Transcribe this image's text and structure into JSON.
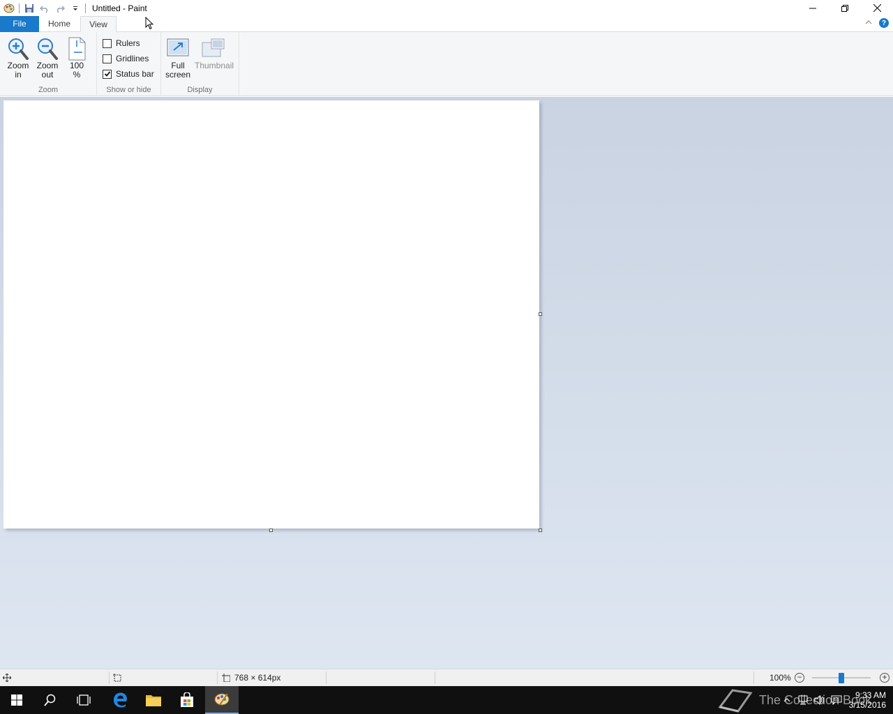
{
  "window": {
    "title": "Untitled - Paint"
  },
  "tabs": {
    "file": "File",
    "home": "Home",
    "view": "View"
  },
  "ribbon": {
    "zoom_group": {
      "label": "Zoom",
      "zoom_in_line1": "Zoom",
      "zoom_in_line2": "in",
      "zoom_out_line1": "Zoom",
      "zoom_out_line2": "out",
      "hundred_line1": "100",
      "hundred_line2": "%"
    },
    "show_hide_group": {
      "label": "Show or hide",
      "rulers": "Rulers",
      "rulers_checked": false,
      "gridlines": "Gridlines",
      "gridlines_checked": false,
      "status_bar": "Status bar",
      "status_bar_checked": true
    },
    "display_group": {
      "label": "Display",
      "full_screen_line1": "Full",
      "full_screen_line2": "screen",
      "thumbnail": "Thumbnail"
    }
  },
  "statusbar": {
    "canvas_size": "768 × 614px",
    "zoom_level": "100%"
  },
  "taskbar": {
    "time": "9:33 AM",
    "date": "3/15/2016",
    "watermark_text": "The Collection Book"
  },
  "colors": {
    "accent": "#1979ca",
    "ribbon_bg": "#f5f6f7",
    "workspace_top": "#c9d3e2",
    "workspace_bottom": "#dde6f1",
    "taskbar_bg": "#101010"
  }
}
